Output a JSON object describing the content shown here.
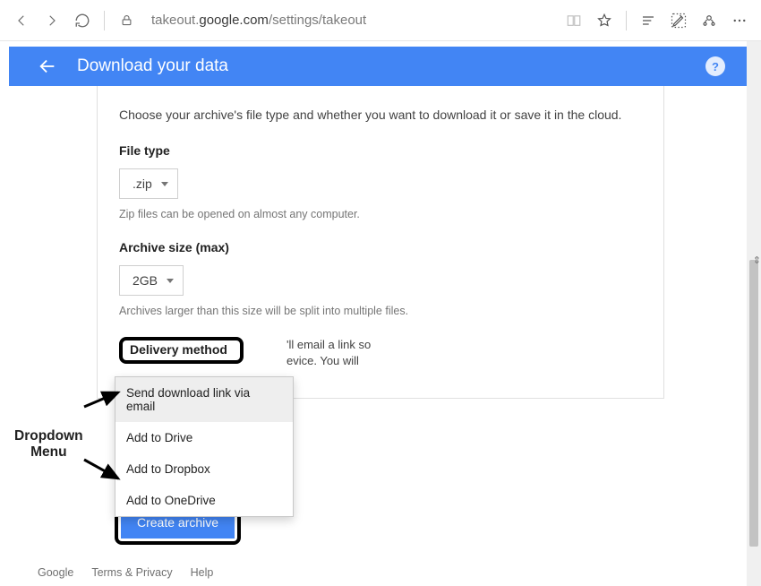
{
  "browser": {
    "url_prefix": "takeout.",
    "url_bold": "google.com",
    "url_suffix": "/settings/takeout"
  },
  "header": {
    "title": "Download your data"
  },
  "card": {
    "intro": "Choose your archive's file type and whether you want to download it or save it in the cloud.",
    "file_type": {
      "label": "File type",
      "value": ".zip",
      "helper": "Zip files can be opened on almost any computer."
    },
    "archive_size": {
      "label": "Archive size (max)",
      "value": "2GB",
      "helper": "Archives larger than this size will be split into multiple files."
    },
    "delivery": {
      "label": "Delivery method",
      "hint_visible": "'ll email a link so evice. You will",
      "options": [
        "Send download link via email",
        "Add to Drive",
        "Add to Dropbox",
        "Add to OneDrive"
      ]
    },
    "cta": "Create archive"
  },
  "annotation": {
    "label_line1": "Dropdown",
    "label_line2": "Menu"
  },
  "footer": {
    "items": [
      "Google",
      "Terms & Privacy",
      "Help"
    ]
  }
}
